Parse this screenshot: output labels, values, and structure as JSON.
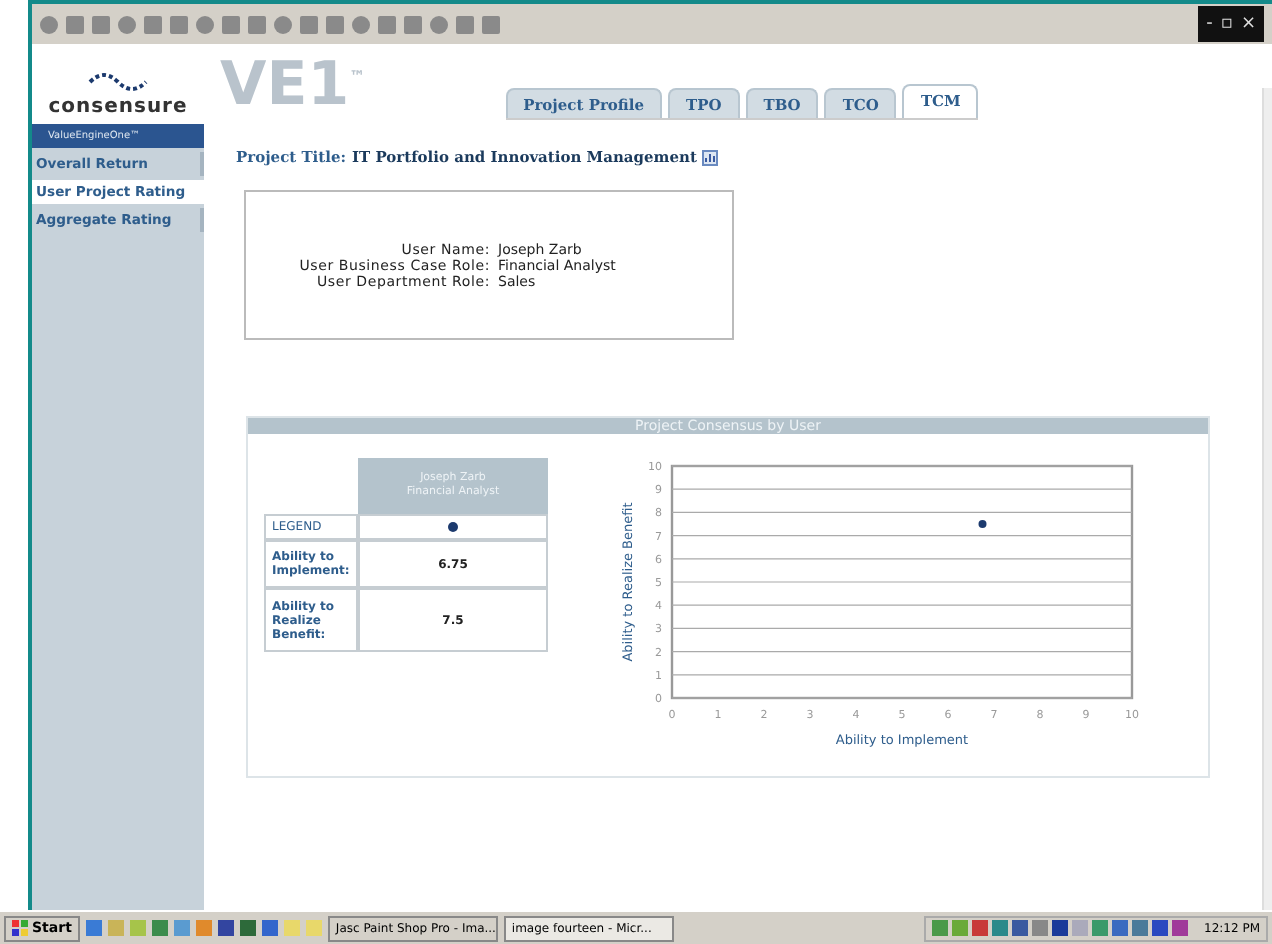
{
  "toolbar": {
    "window_controls": [
      "-",
      "▫",
      "×"
    ]
  },
  "sidebar": {
    "logo": "consensure",
    "banner": "ValueEngineOne™",
    "items": [
      {
        "label": "Overall Return",
        "selected": false
      },
      {
        "label": "User Project Rating",
        "selected": true
      },
      {
        "label": "Aggregate Rating",
        "selected": false
      }
    ]
  },
  "header": {
    "logo": "VE1",
    "logo_mark": "™"
  },
  "tabs": [
    {
      "label": "Project Profile",
      "selected": false
    },
    {
      "label": "TPO",
      "selected": false
    },
    {
      "label": "TBO",
      "selected": false
    },
    {
      "label": "TCO",
      "selected": false
    },
    {
      "label": "TCM",
      "selected": true
    }
  ],
  "project": {
    "label": "Project Title:",
    "title": "IT Portfolio and Innovation Management"
  },
  "user_info": [
    {
      "label": "User Name:",
      "value": "Joseph Zarb"
    },
    {
      "label": "User Business Case Role:",
      "value": "Financial Analyst"
    },
    {
      "label": "User Department Role:",
      "value": "Sales"
    }
  ],
  "panel": {
    "title": "Project Consensus by User",
    "table": {
      "legend_label": "LEGEND",
      "rows": [
        {
          "label": "Ability to Implement:",
          "value": "6.75"
        },
        {
          "label": "Ability to Realize Benefit:",
          "value": "7.5"
        }
      ]
    },
    "chart_data": {
      "type": "scatter",
      "xlabel": "Ability to Implement",
      "ylabel": "Ability to Realize Benefit",
      "x": [
        6.75
      ],
      "series": [
        {
          "name": "Joseph Zarb Financial Analyst",
          "color": "#1c3a6e",
          "values": [
            7.5
          ]
        }
      ],
      "xlim": [
        0,
        10
      ],
      "ylim": [
        0,
        10
      ],
      "grid": true,
      "xticks": [
        0,
        1,
        2,
        3,
        4,
        5,
        6,
        7,
        8,
        9,
        10
      ],
      "yticks": [
        0,
        1,
        2,
        3,
        4,
        5,
        6,
        7,
        8,
        9,
        10
      ]
    }
  },
  "taskbar": {
    "start": "Start",
    "tasks": [
      {
        "label": "Jasc Paint Shop Pro - Ima...",
        "selected": false
      },
      {
        "label": "image fourteen - Micr...",
        "selected": true
      }
    ],
    "clock": "12:12 PM"
  }
}
